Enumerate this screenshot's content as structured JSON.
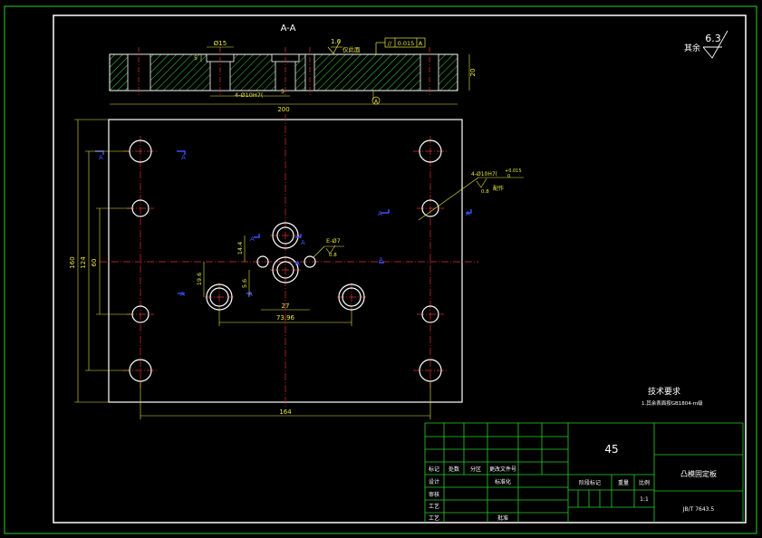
{
  "section_title": "A-A",
  "roughness_other": {
    "label": "其余",
    "value": "6.3"
  },
  "section_view": {
    "dim_hole_dia": "Ø15",
    "dim_depth": "5",
    "dim_thickness": "20",
    "dim_length": "200",
    "dim_pin": "4-Ø10H7(",
    "dim_step": "5",
    "roughness_note_value": "1.6",
    "roughness_note_text": "仅此面",
    "parallel_symbol": "//",
    "parallel_tol": "0.015",
    "datum_top": "A",
    "datum_bottom": "A"
  },
  "plan_view": {
    "dim_width": "164",
    "dim_h160": "160",
    "dim_h124": "124",
    "dim_h60": "60",
    "dim_d14": "14.4",
    "dim_d196": "19.6",
    "dim_d56": "5.6",
    "dim_27": "27",
    "dim_7396": "73.96",
    "note_pin_callout": "4-Ø10H7(",
    "note_pin_tol": "+0.015",
    "note_pin_tail": "0",
    "note_ream": "配作",
    "note_roughness": "0.8",
    "note_e": "E-Ø7",
    "note_e_rough": "0.8",
    "section_mark": "A"
  },
  "tech_req": {
    "title": "技术要求",
    "item1": "1.其余表面按GB1804-m级"
  },
  "title_block": {
    "material": "45",
    "part_name": "凸模固定板",
    "scale": "1:1",
    "standard": "JB/T 7643.5",
    "labels": {
      "mark": "标记",
      "count": "处数",
      "zone": "分区",
      "doc_no": "更改文件号",
      "design": "设计",
      "standardize": "标准化",
      "check": "审核",
      "process": "工艺",
      "approve": "批准",
      "stage_mark": "阶段标记",
      "weight": "重量",
      "ratio": "比例"
    }
  }
}
